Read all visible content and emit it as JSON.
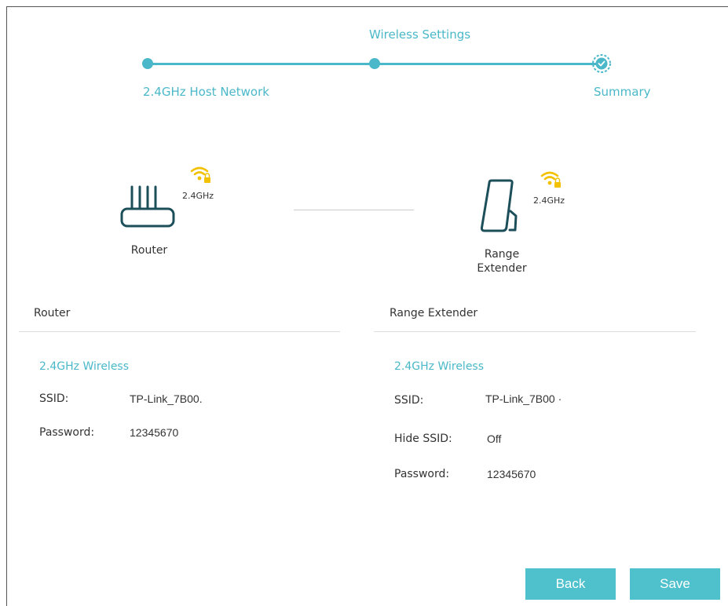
{
  "stepper": {
    "steps": [
      "2.4GHz Host Network",
      "Wireless Settings",
      "Summary"
    ]
  },
  "diagram": {
    "router_label": "Router",
    "extender_label": [
      "Range",
      "Extender"
    ],
    "router_band": "2.4GHz",
    "extender_band": "2.4GHz"
  },
  "router": {
    "title": "Router",
    "subtitle": "2.4GHz Wireless",
    "ssid_label": "SSID:",
    "ssid_value": "TP-Link_7B00.",
    "password_label": "Password:",
    "password_value": "12345670"
  },
  "extender": {
    "title": "Range Extender",
    "subtitle": "2.4GHz Wireless",
    "ssid_label": "SSID:",
    "ssid_value": "TP-Link_7B00 ·",
    "hide_label": "Hide SSID:",
    "hide_value": "Off",
    "password_label": "Password:",
    "password_value": "12345670"
  },
  "buttons": {
    "back": "Back",
    "save": "Save"
  },
  "colors": {
    "accent": "#4ab8c9",
    "button": "#4fc1cc",
    "wifi": "#f2c200",
    "device": "#1d4f5a"
  }
}
